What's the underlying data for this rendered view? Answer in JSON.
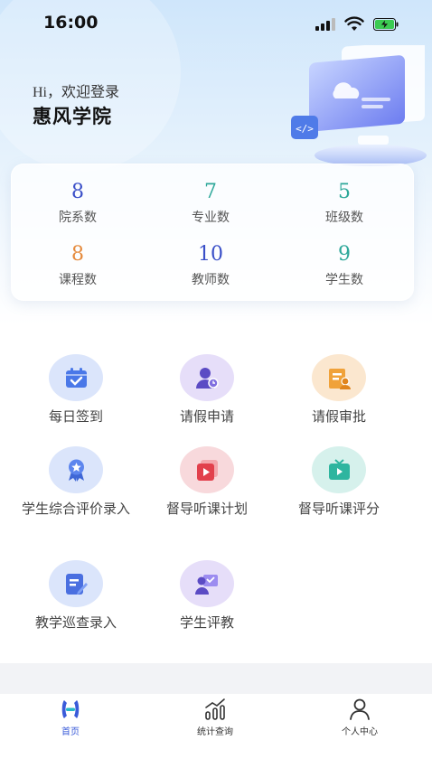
{
  "status_bar": {
    "time": "16:00"
  },
  "header": {
    "greeting": "Hi，欢迎登录",
    "school_name": "惠风学院"
  },
  "stats": [
    {
      "value": "8",
      "label": "院系数",
      "color": "#3a4fc8"
    },
    {
      "value": "7",
      "label": "专业数",
      "color": "#2ea89a"
    },
    {
      "value": "5",
      "label": "班级数",
      "color": "#2ea89a"
    },
    {
      "value": "8",
      "label": "课程数",
      "color": "#e58a3c"
    },
    {
      "value": "10",
      "label": "教师数",
      "color": "#3a4fc8"
    },
    {
      "value": "9",
      "label": "学生数",
      "color": "#2ea89a"
    }
  ],
  "menu": [
    {
      "label": "每日签到",
      "icon": "calendar-check-icon"
    },
    {
      "label": "请假申请",
      "icon": "user-leave-icon"
    },
    {
      "label": "请假审批",
      "icon": "approval-icon"
    },
    {
      "label": "学生综合评价录入",
      "icon": "award-icon"
    },
    {
      "label": "督导听课计划",
      "icon": "video-plan-icon"
    },
    {
      "label": "督导听课评分",
      "icon": "tv-score-icon"
    },
    {
      "label": "教学巡查录入",
      "icon": "edit-note-icon"
    },
    {
      "label": "学生评教",
      "icon": "teacher-review-icon"
    }
  ],
  "tabbar": [
    {
      "label": "首页",
      "icon": "home-logo-icon",
      "active": true
    },
    {
      "label": "统计查询",
      "icon": "chart-icon",
      "active": false
    },
    {
      "label": "个人中心",
      "icon": "user-icon",
      "active": false
    }
  ]
}
